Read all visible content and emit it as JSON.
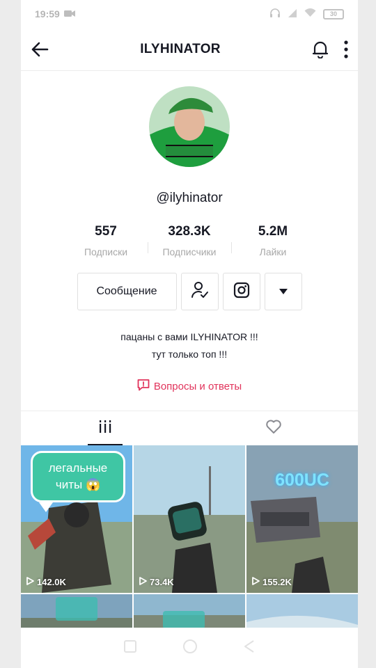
{
  "status_bar": {
    "time": "19:59",
    "battery": "30"
  },
  "header": {
    "title": "ILYHINATOR"
  },
  "profile": {
    "username": "@ilyhinator"
  },
  "stats": [
    {
      "value": "557",
      "label": "Подписки"
    },
    {
      "value": "328.3K",
      "label": "Подписчики"
    },
    {
      "value": "5.2M",
      "label": "Лайки"
    }
  ],
  "actions": {
    "message_label": "Сообщение"
  },
  "bio": {
    "line1": "пацаны с вами ILYHINATOR !!!",
    "line2": "тут только топ !!!"
  },
  "qa": {
    "label": "Вопросы и ответы"
  },
  "videos": [
    {
      "views": "142.0K",
      "overlay": "легальные читы 😱"
    },
    {
      "views": "73.4K"
    },
    {
      "views": "155.2K",
      "overlay": "600UC"
    }
  ],
  "colors": {
    "accent": "#e1335b",
    "text": "#161823",
    "muted": "#a8a8a8",
    "bubble": "#3fc6a4"
  }
}
